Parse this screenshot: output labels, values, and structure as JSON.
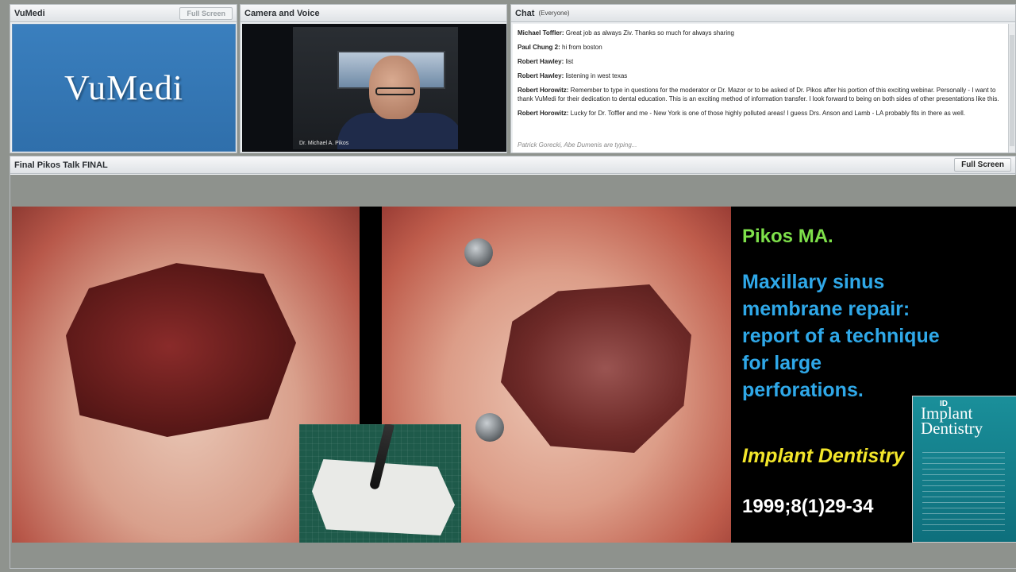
{
  "pods": {
    "vumedi": {
      "title": "VuMedi",
      "fullscreen_label": "Full Screen",
      "logo_text": "VuMedi"
    },
    "camera": {
      "title": "Camera and Voice",
      "caption": "Dr. Michael A. Pikos"
    },
    "chat": {
      "title": "Chat",
      "audience": "(Everyone)",
      "messages": [
        {
          "author": "Michael Toffler:",
          "text": "Great job as always Ziv. Thanks so much for always sharing"
        },
        {
          "author": "Paul Chung 2:",
          "text": "hi from boston"
        },
        {
          "author": "Robert Hawley:",
          "text": "list"
        },
        {
          "author": "Robert Hawley:",
          "text": "listening in west texas"
        },
        {
          "author": "Robert Horowitz:",
          "text": "Remember to type in questions for the moderator or Dr. Mazor or to be asked of Dr. Pikos after his portion of this exciting webinar. Personally - I want to thank VuMedi for their dedication to dental education. This is an exciting method of information transfer. I look forward to being on both sides of other presentations like this."
        },
        {
          "author": "Robert Horowitz:",
          "text": "Lucky for Dr. Toffler and me - New York is one of those highly polluted areas! I guess Drs. Anson and Lamb - LA probably fits in there as well."
        }
      ],
      "typing": "Patrick Gorecki, Abe Dumenis are typing..."
    },
    "main": {
      "title": "Final Pikos Talk FINAL",
      "fullscreen_label": "Full Screen"
    }
  },
  "slide": {
    "author": "Pikos MA.",
    "title": "Maxillary sinus membrane repair: report of a technique for large perforations.",
    "journal": "Implant Dentistry",
    "citation": "1999;8(1)29-34",
    "cover": {
      "badge": "ID",
      "title": "Implant Dentistry"
    },
    "colors": {
      "author": "#7ee04a",
      "title": "#2fa8e8",
      "journal": "#f2e52a",
      "citation": "#ffffff"
    }
  }
}
